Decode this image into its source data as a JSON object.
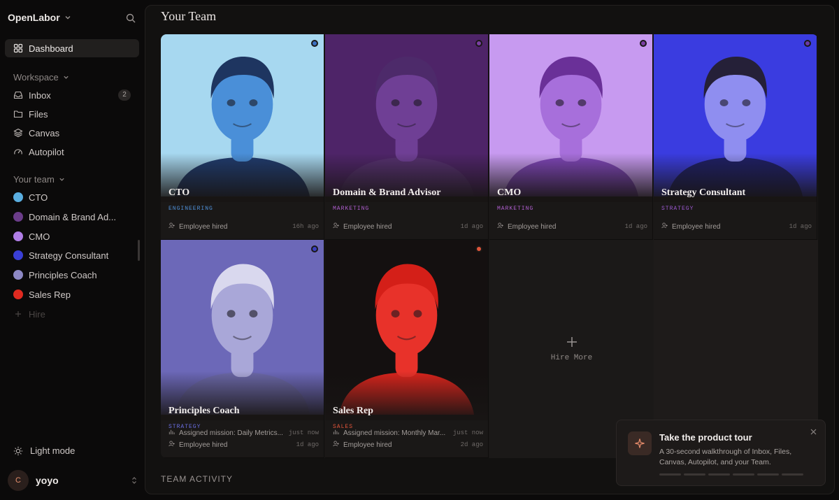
{
  "sidebar": {
    "brand": "OpenLabor",
    "nav": [
      {
        "label": "Dashboard",
        "icon": "grid-icon",
        "active": true
      },
      {
        "label": "Inbox",
        "icon": "inbox-icon",
        "badge": "2"
      },
      {
        "label": "Files",
        "icon": "folder-icon"
      },
      {
        "label": "Canvas",
        "icon": "layers-icon"
      },
      {
        "label": "Autopilot",
        "icon": "gauge-icon"
      }
    ],
    "workspace_label": "Workspace",
    "team_label": "Your team",
    "team": [
      {
        "label": "CTO",
        "color": "#5aaee0"
      },
      {
        "label": "Domain & Brand Ad...",
        "color": "#6b3d8a"
      },
      {
        "label": "CMO",
        "color": "#b07ee6"
      },
      {
        "label": "Strategy Consultant",
        "color": "#3a3fd6"
      },
      {
        "label": "Principles Coach",
        "color": "#8d88c4"
      },
      {
        "label": "Sales Rep",
        "color": "#e02a20"
      }
    ],
    "hire_label": "Hire",
    "light_mode_label": "Light mode",
    "user": {
      "initial": "C",
      "name": "yoyo"
    }
  },
  "main": {
    "title": "Your Team",
    "team_activity_label": "TEAM ACTIVITY"
  },
  "cards": [
    {
      "role": "CTO",
      "dept": "ENGINEERING",
      "dept_color": "#4f8fd6",
      "dot": "#3a6fc0",
      "bg": "#a7d8f0",
      "skin": "#4a8fd8",
      "hair": "#1e3560",
      "shirt": "#1f3b6e",
      "activities": [
        {
          "icon": "user-plus-icon",
          "text": "Employee hired",
          "when": "16h ago"
        }
      ]
    },
    {
      "role": "Domain & Brand Advisor",
      "dept": "MARKETING",
      "dept_color": "#b05fd0",
      "dot": "#7b3fa3",
      "bg": "#4e2468",
      "skin": "#6f3f95",
      "hair": "#4d2a6a",
      "shirt": "#55306f",
      "activities": [
        {
          "icon": "user-plus-icon",
          "text": "Employee hired",
          "when": "1d ago"
        }
      ]
    },
    {
      "role": "CMO",
      "dept": "MARKETING",
      "dept_color": "#b05fd0",
      "dot": "#7b3fa3",
      "bg": "#c79af0",
      "skin": "#a76fdb",
      "hair": "#6a3098",
      "shirt": "#7f46b8",
      "activities": [
        {
          "icon": "user-plus-icon",
          "text": "Employee hired",
          "when": "1d ago"
        }
      ]
    },
    {
      "role": "Strategy Consultant",
      "dept": "STRATEGY",
      "dept_color": "#9b59d0",
      "dot": "#6a3aa8",
      "bg": "#3a3ce0",
      "skin": "#8f8ef0",
      "hair": "#252038",
      "shirt": "#1e1f66",
      "activities": [
        {
          "icon": "user-plus-icon",
          "text": "Employee hired",
          "when": "1d ago"
        }
      ]
    },
    {
      "role": "Principles Coach",
      "dept": "STRATEGY",
      "dept_color": "#6a6ee0",
      "dot": "#3b3fc0",
      "bg": "#6c68b8",
      "skin": "#a9a7d8",
      "hair": "#d9d8ee",
      "shirt": "#6a67a6",
      "activities": [
        {
          "icon": "chart-icon",
          "text": "Assigned mission: Daily Metrics...",
          "when": "just now"
        },
        {
          "icon": "user-plus-icon",
          "text": "Employee hired",
          "when": "1d ago"
        }
      ]
    },
    {
      "role": "Sales Rep",
      "dept": "SALES",
      "dept_color": "#e0553a",
      "dot": "#e0553a",
      "bg": "#141010",
      "skin": "#e8322a",
      "hair": "#d41f18",
      "shirt": "#d8241c",
      "activities": [
        {
          "icon": "chart-icon",
          "text": "Assigned mission: Monthly Mar...",
          "when": "just now"
        },
        {
          "icon": "user-plus-icon",
          "text": "Employee hired",
          "when": "2d ago"
        }
      ]
    }
  ],
  "hire_more_label": "Hire More",
  "tour": {
    "title": "Take the product tour",
    "description": "A 30-second walkthrough of Inbox, Files, Canvas, Autopilot, and your Team.",
    "steps_total": 6
  }
}
